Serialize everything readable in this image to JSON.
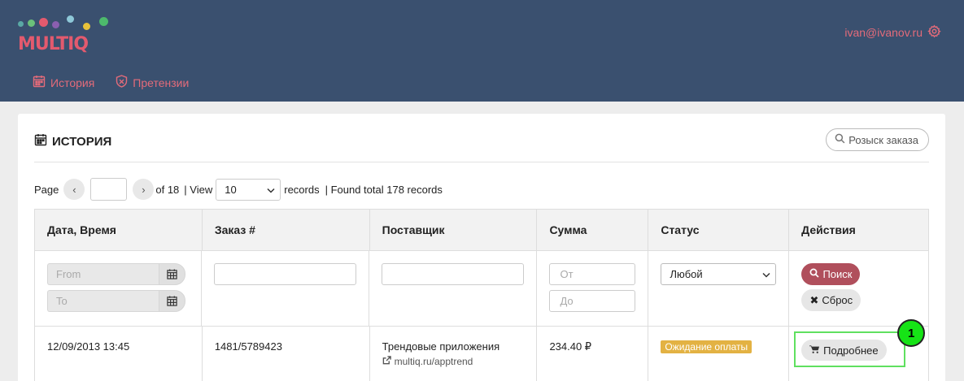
{
  "app": {
    "logo_text": "MULTIQ",
    "user_email": "ivan@ivanov.ru"
  },
  "nav": {
    "items": [
      {
        "label": "История",
        "icon": "calendar-icon"
      },
      {
        "label": "Претензии",
        "icon": "shield-icon"
      }
    ]
  },
  "card": {
    "title": "ИСТОРИЯ",
    "search_order_label": "Розыск заказа"
  },
  "pager": {
    "page_label": "Page",
    "of_label": "of 18",
    "view_label": "| View",
    "per_page": "10",
    "records_label": "records",
    "found_label": "| Found total 178 records"
  },
  "table": {
    "columns": [
      "Дата, Время",
      "Заказ #",
      "Поставщик",
      "Сумма",
      "Статус",
      "Действия"
    ],
    "filters": {
      "date_from_placeholder": "From",
      "date_to_placeholder": "To",
      "amount_from_placeholder": "От",
      "amount_to_placeholder": "До",
      "status_value": "Любой",
      "search_label": "Поиск",
      "reset_label": "Сброс"
    },
    "rows": [
      {
        "datetime": "12/09/2013 13:45",
        "order": "1481/5789423",
        "supplier": "Трендовые приложения",
        "supplier_link": "multiq.ru/apptrend",
        "amount": "234.40 ₽",
        "status": "Ожидание оплаты",
        "action_label": "Подробнее"
      }
    ]
  },
  "annotation": {
    "marker": "1"
  },
  "colors": {
    "header_bg": "#3a506f",
    "accent": "#e36b7a",
    "search_button": "#b04f5c",
    "status_badge": "#e3b243",
    "highlight": "#16e316"
  }
}
